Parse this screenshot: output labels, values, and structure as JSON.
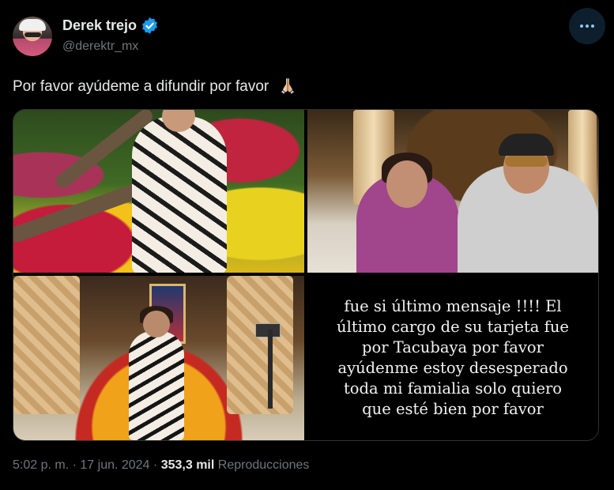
{
  "author": {
    "name": "Derek trejo",
    "handle": "@derektr_mx",
    "verified": true
  },
  "tweet": {
    "text": "Por favor ayúdeme a difundir por favor",
    "emoji": "folded-hands"
  },
  "media": {
    "story_text_lines": [
      "fue si último mensaje !!!! El",
      "último cargo de su tarjeta fue",
      "por Tacubaya  por favor",
      "ayúdenme estoy desesperado",
      "toda mi famialia solo quiero",
      "que esté bien por favor"
    ]
  },
  "meta": {
    "time": "5:02 p. m.",
    "sep1": "·",
    "date": "17 jun. 2024",
    "sep2": "·",
    "views_count": "353,3 mil",
    "views_label": "Reproducciones"
  },
  "colors": {
    "background": "#000000",
    "text": "#e7e9ea",
    "muted": "#71767b",
    "verified": "#1d9bf0"
  }
}
